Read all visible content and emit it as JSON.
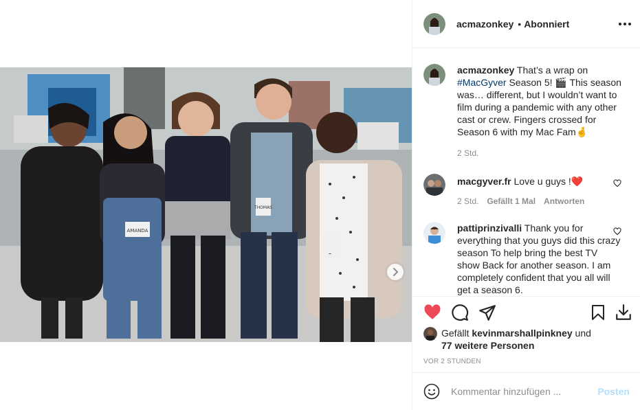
{
  "post": {
    "author": "acmazonkey",
    "separator": "•",
    "follow_status": "Abonniert",
    "more_icon": "more-options-icon"
  },
  "caption": {
    "username": "acmazonkey",
    "text_before": "That’s a wrap on",
    "hashtag": "#MacGyver",
    "text_after": "Season 5! 🎬 This season was… different, but I wouldn’t want to film during a pandemic with any other cast or crew. Fingers crossed for Season 6 with my Mac Fam🤞",
    "time": "2 Std."
  },
  "comments": [
    {
      "username": "macgyver.fr",
      "text": "Love u guys !❤️",
      "time": "2 Std.",
      "likes": "Gefällt 1 Mal",
      "reply": "Antworten"
    },
    {
      "username": "pattiprinzivalli",
      "text": "Thank you for everything that you guys did this crazy season To help bring the best TV show Back for another season. I am completely confident that you all will get a season 6."
    }
  ],
  "likes": {
    "prefix": "Gefällt",
    "liker": "kevinmarshallpinkney",
    "conjunction": "und",
    "others": "77 weitere Personen"
  },
  "timestamp": "VOR 2 STUNDEN",
  "add_comment": {
    "placeholder": "Kommentar hinzufügen ...",
    "post_label": "Posten"
  },
  "badges": {
    "amanda": "AMANDA",
    "thomas": "THOMAS"
  },
  "colors": {
    "like_red": "#ed4956",
    "link_blue": "#00376b",
    "post_disabled": "#b2dffc",
    "muted_text": "#8e8e8e"
  }
}
